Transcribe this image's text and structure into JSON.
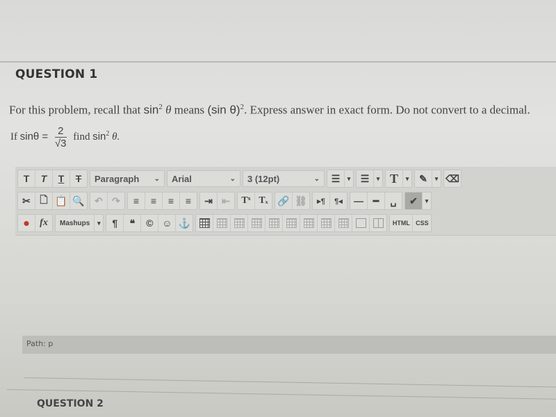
{
  "question1": {
    "title": "QUESTION 1",
    "intro_a": "For this problem, recall that ",
    "sin": "sin",
    "exp": "2",
    "theta": " θ",
    "means": " means ",
    "paren": "(sin θ)",
    "rest": ". Express answer in exact form. Do not convert to a decimal.",
    "eq_if": "If ",
    "eq_sin": "sinθ =",
    "frac_num": "2",
    "frac_den": "√3",
    "eq_find": "find ",
    "eq_theta_end": " θ."
  },
  "toolbar": {
    "row1": {
      "bold": "T",
      "italic": "T",
      "underline": "T",
      "strike": "T",
      "format_select": "Paragraph",
      "font_select": "Arial",
      "size_select": "3 (12pt)",
      "bullet_list": "☰",
      "numbered_list": "☰",
      "text_color": "T",
      "highlight": "✎",
      "eraser": "⌫",
      "dropdown": "▾",
      "chevron": "⌄"
    },
    "row2": {
      "cut": "✂",
      "copy": "🗋",
      "paste": "📋",
      "find": "🔍",
      "undo": "↶",
      "redo": "↷",
      "align_left": "≡",
      "align_center": "≡",
      "align_right": "≡",
      "justify": "≡",
      "indent": "⇥",
      "outdent": "⇤",
      "superscript": "Tˣ",
      "subscript": "Tₓ",
      "link": "🔗",
      "unlink": "⛓",
      "ltr": "▸¶",
      "rtl": "¶◂",
      "hr": "—",
      "hr_thick": "━",
      "nbsp": "␣",
      "spellcheck": "✔"
    },
    "row3": {
      "record": "⏺",
      "math": "fx",
      "mashups": "Mashups",
      "paragraph_mark": "¶",
      "quote": "❝",
      "copyright": "©",
      "emoji": "☺",
      "anchor": "⚓",
      "html": "HTML",
      "css": "CSS"
    }
  },
  "path_bar": "Path: p",
  "question2": {
    "title": "QUESTION 2"
  }
}
